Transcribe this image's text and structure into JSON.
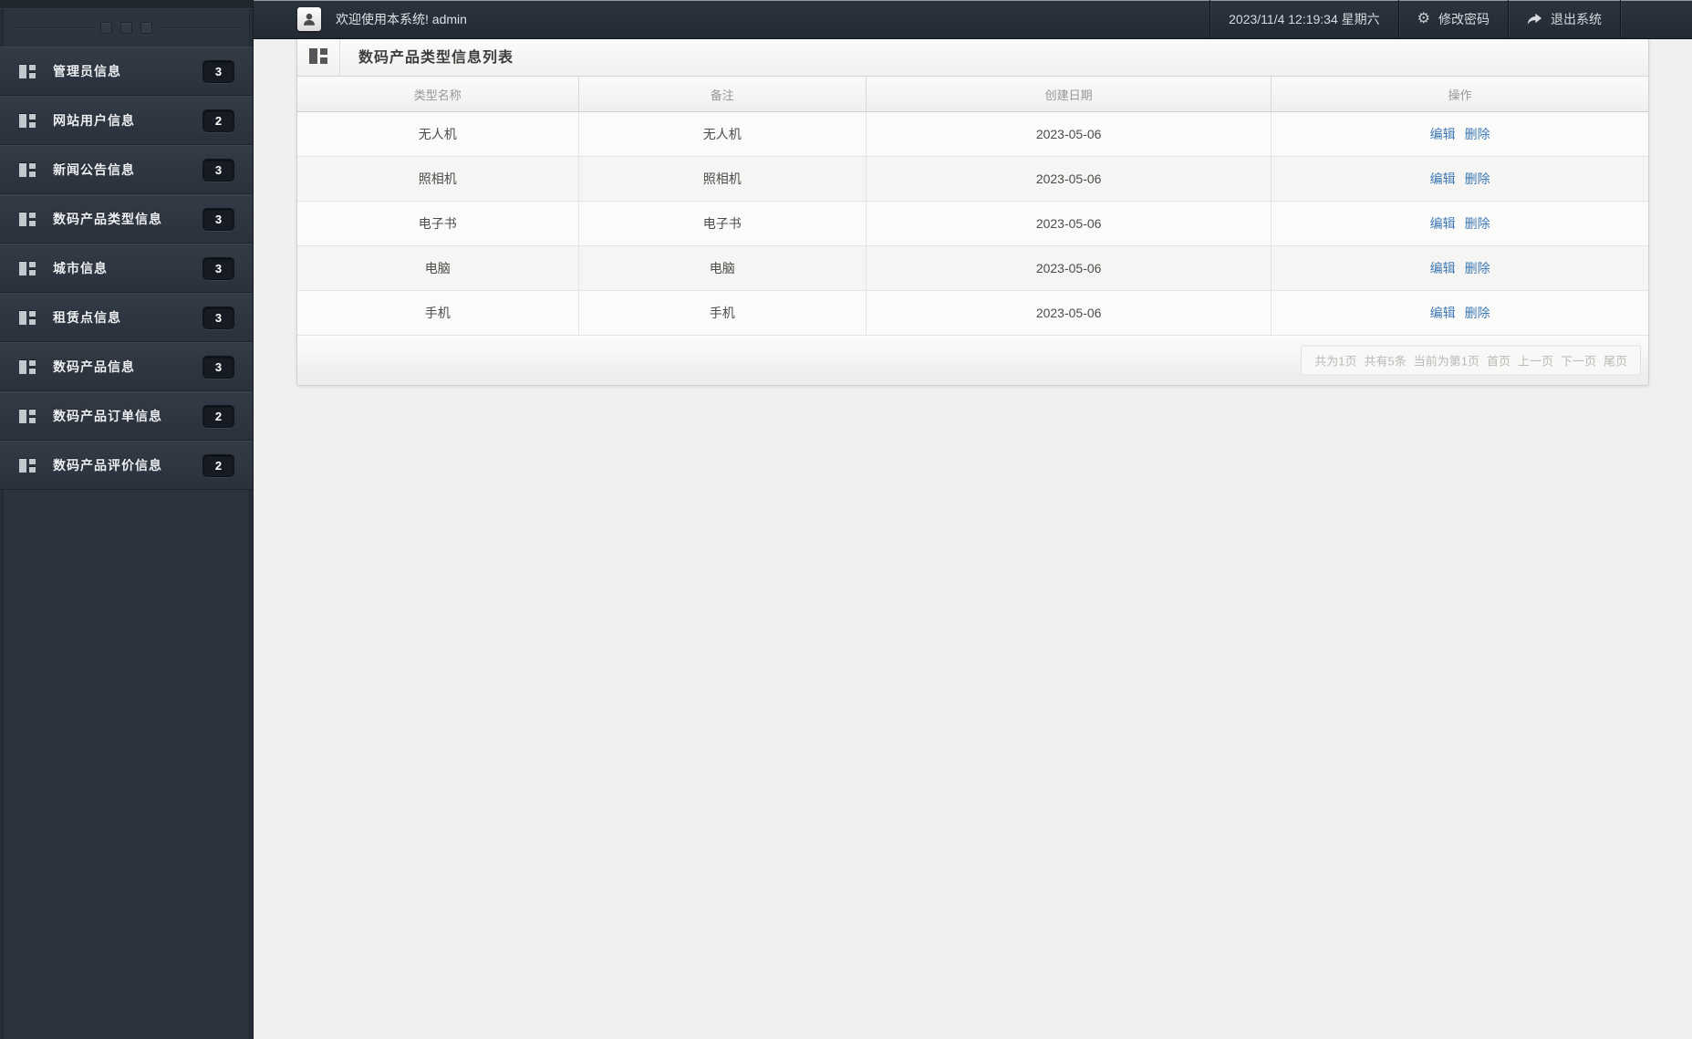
{
  "colors": {
    "main_bg": "#f0f0ee",
    "sidebar_bg": "#2c3440",
    "topbar_bg": "#2b333d",
    "badge_bg": "#171c24",
    "accent_link": "#3d79b5"
  },
  "topbar": {
    "welcome": "欢迎使用本系统! admin",
    "datetime": "2023/11/4 12:19:34 星期六",
    "change_password": "修改密码",
    "logout": "退出系统"
  },
  "sidebar": {
    "items": [
      {
        "label": "管理员信息",
        "badge": "3"
      },
      {
        "label": "网站用户信息",
        "badge": "2"
      },
      {
        "label": "新闻公告信息",
        "badge": "3"
      },
      {
        "label": "数码产品类型信息",
        "badge": "3"
      },
      {
        "label": "城市信息",
        "badge": "3"
      },
      {
        "label": "租赁点信息",
        "badge": "3"
      },
      {
        "label": "数码产品信息",
        "badge": "3"
      },
      {
        "label": "数码产品订单信息",
        "badge": "2"
      },
      {
        "label": "数码产品评价信息",
        "badge": "2"
      }
    ]
  },
  "panel": {
    "title": "数码产品类型信息列表",
    "table": {
      "headers": [
        "类型名称",
        "备注",
        "创建日期",
        "操作"
      ],
      "col_widths": [
        "20.8%",
        "21.3%",
        "30.0%",
        "27.9%"
      ],
      "edit_label": "编辑",
      "delete_label": "删除",
      "rows": [
        {
          "type": "无人机",
          "remark": "无人机",
          "date": "2023-05-06"
        },
        {
          "type": "照相机",
          "remark": "照相机",
          "date": "2023-05-06"
        },
        {
          "type": "电子书",
          "remark": "电子书",
          "date": "2023-05-06"
        },
        {
          "type": "电脑",
          "remark": "电脑",
          "date": "2023-05-06"
        },
        {
          "type": "手机",
          "remark": "手机",
          "date": "2023-05-06"
        }
      ]
    },
    "pagination": {
      "info": [
        "共为1页",
        "共有5条",
        "当前为第1页"
      ],
      "links": [
        "首页",
        "上一页",
        "下一页",
        "尾页"
      ]
    }
  }
}
